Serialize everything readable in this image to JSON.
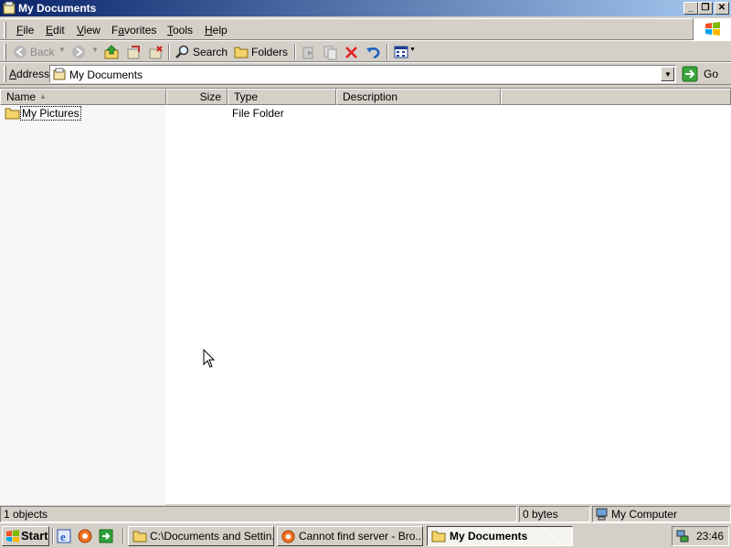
{
  "window": {
    "title": "My Documents"
  },
  "menu": [
    "File",
    "Edit",
    "View",
    "Favorites",
    "Tools",
    "Help"
  ],
  "menu_accel": [
    "F",
    "E",
    "V",
    "a",
    "T",
    "H"
  ],
  "toolbar": {
    "back_label": "Back",
    "search_label": "Search",
    "folders_label": "Folders"
  },
  "address": {
    "label": "Address",
    "value": "My Documents",
    "go_label": "Go"
  },
  "list": {
    "columns": [
      "Name",
      "Size",
      "Type",
      "Description"
    ],
    "rows": [
      {
        "name": "My Pictures",
        "size": "",
        "type": "File Folder",
        "description": ""
      }
    ]
  },
  "status": {
    "objects": "1 objects",
    "size": "0 bytes",
    "zone": "My Computer"
  },
  "taskbar": {
    "start_label": "Start",
    "tasks": [
      {
        "label": "C:\\Documents and Settin...",
        "icon": "folder-icon",
        "active": false
      },
      {
        "label": "Cannot find server - Bro...",
        "icon": "browser-icon",
        "active": false
      },
      {
        "label": "My Documents",
        "icon": "folder-icon",
        "active": true
      }
    ],
    "clock": "23:46"
  },
  "colors": {
    "title_start": "#0a246a",
    "title_end": "#a6caf0",
    "face": "#d4d0c8"
  }
}
